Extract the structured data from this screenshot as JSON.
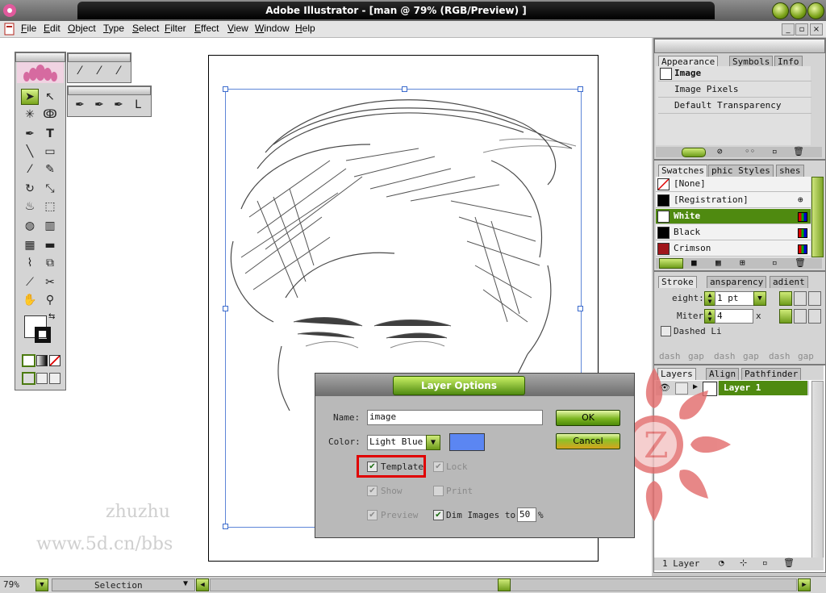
{
  "window": {
    "title": "Adobe Illustrator - [man @ 79% (RGB/Preview) ]"
  },
  "menu": [
    "File",
    "Edit",
    "Object",
    "Type",
    "Select",
    "Filter",
    "Effect",
    "View",
    "Window",
    "Help"
  ],
  "canvas": {
    "watermark_line1": "zhuzhu",
    "watermark_line2": "www.5d.cn/bbs"
  },
  "appearance_panel": {
    "tabs": [
      "Appearance",
      "Symbols",
      "Info"
    ],
    "items": [
      "Image",
      "Image Pixels",
      "Default Transparency"
    ]
  },
  "swatches_panel": {
    "tabs": [
      "Swatches",
      "phic Styles",
      "shes"
    ],
    "items": [
      {
        "name": "[None]",
        "color": "#ffffff"
      },
      {
        "name": "[Registration]",
        "color": "#000000"
      },
      {
        "name": "White",
        "color": "#ffffff"
      },
      {
        "name": "Black",
        "color": "#000000"
      },
      {
        "name": "Crimson",
        "color": "#a0161b"
      }
    ],
    "selected": "White"
  },
  "stroke_panel": {
    "tabs": [
      "Stroke",
      "ansparency",
      "adient"
    ],
    "weight_label": "eight:",
    "weight_value": "1 pt",
    "miter_label": "Miter",
    "miter_value": "4",
    "miter_unit": "x",
    "dashed_label": "Dashed Li",
    "dash_labels": [
      "dash",
      "gap",
      "dash",
      "gap",
      "dash",
      "gap"
    ]
  },
  "layers_panel": {
    "tabs": [
      "Layers",
      "Align",
      "Pathfinder"
    ],
    "layer_name": "Layer 1",
    "footer": "1 Layer"
  },
  "dialog": {
    "title": "Layer Options",
    "name_label": "Name:",
    "name_value": "image",
    "color_label": "Color:",
    "color_value": "Light Blue",
    "swatch_color": "#5b86f2",
    "ok": "OK",
    "cancel": "Cancel",
    "template": "Template",
    "lock": "Lock",
    "show": "Show",
    "print": "Print",
    "preview": "Preview",
    "dim_images": "Dim Images to:",
    "dim_value": "50",
    "dim_unit": "%"
  },
  "status": {
    "zoom": "79%",
    "tool": "Selection"
  },
  "accent": "#7aa51c"
}
